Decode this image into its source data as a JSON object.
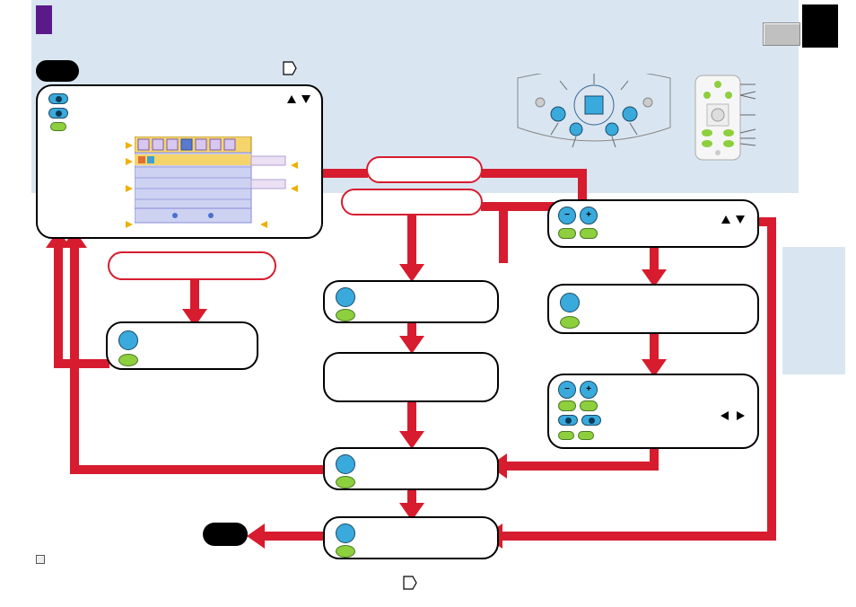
{
  "diagram": {
    "start_label": "",
    "end_label": "",
    "icons": {
      "pentagon_top": "pentagon-icon",
      "pentagon_bottom": "pentagon-icon",
      "triangle_up": "triangle-up-icon",
      "triangle_down": "triangle-down-icon",
      "triangle_left": "triangle-left-icon",
      "triangle_right": "triangle-right-icon",
      "minus": "−",
      "plus": "+"
    },
    "nodes": {
      "main_menu": {
        "label": ""
      },
      "red_step_1": {
        "label": ""
      },
      "red_step_2": {
        "label": ""
      },
      "red_step_3": {
        "label": ""
      },
      "auto_search_1": {
        "label": ""
      },
      "auto_search_2": {
        "label": ""
      },
      "auto_search_3": {
        "label": ""
      },
      "auto_search_4": {
        "label": ""
      },
      "manual_tune_1": {
        "label": ""
      },
      "manual_tune_2": {
        "label": ""
      },
      "manual_tune_3": {
        "label": ""
      },
      "store": {
        "label": ""
      }
    },
    "illustrations": {
      "control_panel": "control-panel-illustration",
      "remote": "remote-control-illustration",
      "onscreen_menu": "onscreen-menu-illustration"
    },
    "colors": {
      "red": "#d71c2f",
      "blue": "#3aaadd",
      "green": "#8ecf3e",
      "bg_blue": "#d9e6f2",
      "purple": "#5a1a8a"
    }
  }
}
